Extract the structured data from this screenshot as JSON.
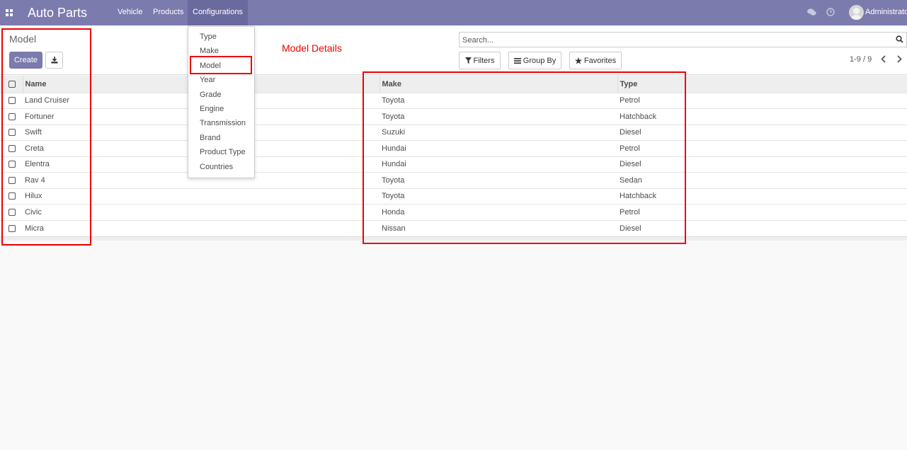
{
  "app": {
    "title": "Auto Parts",
    "menu": [
      {
        "label": "Vehicle"
      },
      {
        "label": "Products"
      },
      {
        "label": "Configurations"
      }
    ],
    "user": "Administrator"
  },
  "page": {
    "title": "Model",
    "create_label": "Create",
    "annotation": "Model Details"
  },
  "search": {
    "placeholder": "Search..."
  },
  "filters": {
    "filters_label": "Filters",
    "group_by_label": "Group By",
    "favorites_label": "Favorites"
  },
  "pager": {
    "value": "1-9 / 9"
  },
  "dropdown": {
    "items": [
      "Type",
      "Make",
      "Model",
      "Year",
      "Grade",
      "Engine",
      "Transmission",
      "Brand",
      "Product Type",
      "Countries"
    ],
    "selected": "Model"
  },
  "table": {
    "columns": [
      "Name",
      "Make",
      "Type"
    ],
    "rows": [
      {
        "name": "Land Cruiser",
        "make": "Toyota",
        "type": "Petrol"
      },
      {
        "name": "Fortuner",
        "make": "Toyota",
        "type": "Hatchback"
      },
      {
        "name": "Swift",
        "make": "Suzuki",
        "type": "Diesel"
      },
      {
        "name": "Creta",
        "make": "Hundai",
        "type": "Petrol"
      },
      {
        "name": "Elentra",
        "make": "Hundai",
        "type": "Diesel"
      },
      {
        "name": "Rav 4",
        "make": "Toyota",
        "type": "Sedan"
      },
      {
        "name": "Hilux",
        "make": "Toyota",
        "type": "Hatchback"
      },
      {
        "name": "Civic",
        "make": "Honda",
        "type": "Petrol"
      },
      {
        "name": "Micra",
        "make": "Nissan",
        "type": "Diesel"
      }
    ]
  },
  "colors": {
    "brand": "#7c7bad",
    "annotation": "#e00000"
  }
}
